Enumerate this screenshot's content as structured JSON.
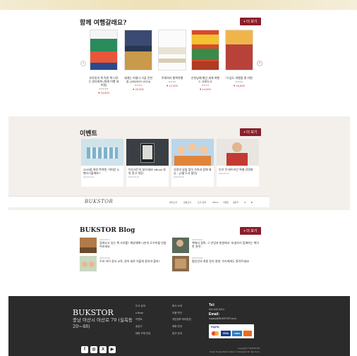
{
  "books_section": {
    "title": "함께 여행갈래요?",
    "more_label": "+ 더 보기",
    "prev_icon": "‹",
    "next_icon": "›",
    "books": [
      {
        "title": "유아동의 책 직관 책 다루는 망라회화 (체계 어행 세미원)",
        "rating": "★★★★★",
        "price": "♥ 16,600"
      },
      {
        "title": "세계는 아름다 가끔 전한 꿈 (1952023~2024)",
        "rating": "★★★★",
        "price": "♥ 22,000"
      },
      {
        "title": "주례여러 행복여행",
        "rating": "★★★★",
        "price": "♥ 12,000"
      },
      {
        "title": "온한남예 행산 세계 여행 2: 고대도시",
        "rating": "★★★★",
        "price": "♥ 14,000"
      },
      {
        "title": "이 없도 여행을 열 자편",
        "rating": "★★★★",
        "price": "♥ 16,800"
      }
    ]
  },
  "events_section": {
    "title": "이벤트",
    "more_label": "+ 더 보기",
    "events": [
      {
        "title": "2020을 위한 북큐텐, 어떠운 노 행사시할래요?",
        "date": "2023.03.19"
      },
      {
        "title": "어디서든지 읽으세요! eBook 대량 정고 개당!",
        "date": "2023.05.16"
      },
      {
        "title": "가정의 달을 맞아 가족과 함께 제공... [2월 도서 할인]",
        "date": "2023.05.06"
      },
      {
        "title": "인기 작 테트라던 특별 강연회",
        "date": "2023.06.21"
      }
    ]
  },
  "minibar": {
    "logo": "BUKSTOR",
    "nav": [
      "팔리고서",
      "집중도서",
      "도서 검색",
      "eBook",
      "이벤트",
      "공유기",
      "Q",
      "■"
    ]
  },
  "blog_section": {
    "title": "BUKSTOR Blog",
    "more_label": "+ 더 보기",
    "posts": [
      {
        "date": "2023.05.01",
        "text": "집에오고 있는 책 가지를? 해양재해 나만의 도우미을 만들어보세요."
      },
      {
        "date": "2023.05.04",
        "text": "책에서 걸특, 그 안녕과 현생에서 \"호생속이 함께하는 책이 한 권씩\"."
      },
      {
        "date": "2023.05.06",
        "text": "우리 아이 정서 교육, 영어 새로 이붙게 좋아야 할까?"
      },
      {
        "date": "2023.05.08",
        "text": "평상인의 최종 정치 영향, 우리에게도 알려주세요!"
      }
    ]
  },
  "footer": {
    "brand": "BUKSTOR",
    "address": "충남 아산시 아산로 79 (실옥동 20~48)",
    "links_col1": [
      "도서 검색",
      "e-Book",
      "이벤트",
      "공공고",
      "대량 구매 안내"
    ],
    "links_col2": [
      "회사 소개",
      "이용 약관",
      "개인정보 처리방침",
      "제휴 안내",
      "광고 안내"
    ],
    "tel_label": "Tel:",
    "tel_value": "041-542-0214",
    "email_label": "Email:",
    "email_value": "inquiry@BUKSTOR.co.kr",
    "payments": [
      "PayPal",
      "VISA",
      "AMEX"
    ],
    "social": [
      "facebook-icon",
      "instagram-icon",
      "x-icon",
      "youtube-icon"
    ],
    "social_glyphs": [
      "f",
      "◎",
      "X",
      "▶"
    ],
    "copyright": "Copyright © BUKSTOR",
    "credit": "Origin Design Book Culture © Designed for Jae Yoon"
  }
}
